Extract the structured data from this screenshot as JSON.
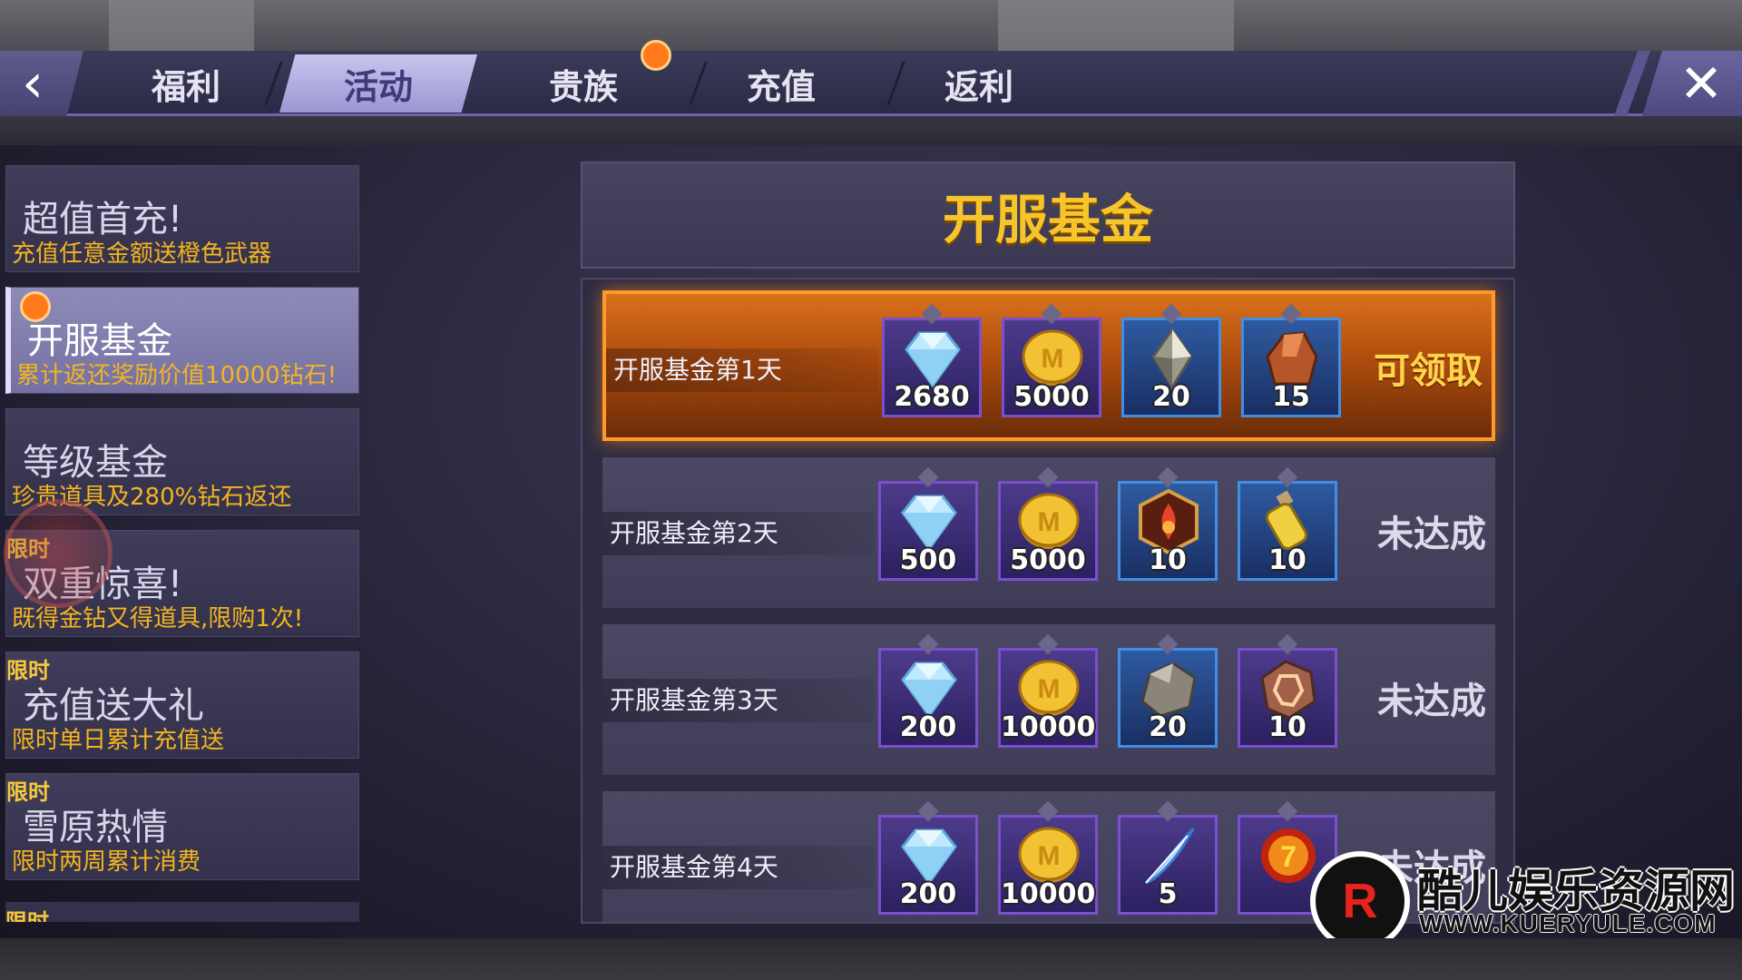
{
  "tabs": [
    {
      "label": "福利",
      "active": false
    },
    {
      "label": "活动",
      "active": true
    },
    {
      "label": "贵族",
      "active": false,
      "notify": true
    },
    {
      "label": "充值",
      "active": false
    },
    {
      "label": "返利",
      "active": false
    }
  ],
  "icons": {
    "back": "back-arrow-icon",
    "close": "close-icon"
  },
  "sidebar": {
    "items": [
      {
        "title": "超值首充!",
        "subtitle": "充值任意金额送橙色武器",
        "tag": "",
        "active": false
      },
      {
        "title": "开服基金",
        "subtitle": "累计返还奖励价值10000钻石!",
        "tag": "",
        "active": true,
        "notify": true
      },
      {
        "title": "等级基金",
        "subtitle": "珍贵道具及280%钻石返还",
        "tag": "",
        "active": false
      },
      {
        "title": "双重惊喜!",
        "subtitle": "既得金钻又得道具,限购1次!",
        "tag": "限时",
        "active": false
      },
      {
        "title": "充值送大礼",
        "subtitle": "限时单日累计充值送",
        "tag": "限时",
        "active": false
      },
      {
        "title": "雪原热情",
        "subtitle": "限时两周累计消费",
        "tag": "限时",
        "active": false
      }
    ],
    "partial_tag": "限时"
  },
  "panel": {
    "title": "开服基金",
    "rows": [
      {
        "label": "开服基金第1天",
        "status": "可领取",
        "claimable": true,
        "rewards": [
          {
            "icon": "diamond-icon",
            "count": "2680",
            "frame": "purple"
          },
          {
            "icon": "gold-coin-icon",
            "count": "5000",
            "frame": "purple"
          },
          {
            "icon": "crystal-shard-icon",
            "count": "20",
            "frame": "blue"
          },
          {
            "icon": "ore-icon",
            "count": "15",
            "frame": "blue"
          }
        ]
      },
      {
        "label": "开服基金第2天",
        "status": "未达成",
        "claimable": false,
        "rewards": [
          {
            "icon": "diamond-icon",
            "count": "500",
            "frame": "purple"
          },
          {
            "icon": "gold-coin-icon",
            "count": "5000",
            "frame": "purple"
          },
          {
            "icon": "fire-emblem-icon",
            "count": "10",
            "frame": "blue"
          },
          {
            "icon": "potion-icon",
            "count": "10",
            "frame": "blue"
          }
        ]
      },
      {
        "label": "开服基金第3天",
        "status": "未达成",
        "claimable": false,
        "rewards": [
          {
            "icon": "diamond-icon",
            "count": "200",
            "frame": "purple"
          },
          {
            "icon": "gold-coin-icon",
            "count": "10000",
            "frame": "purple"
          },
          {
            "icon": "stone-icon",
            "count": "20",
            "frame": "blue"
          },
          {
            "icon": "rune-stone-icon",
            "count": "10",
            "frame": "purple"
          }
        ]
      },
      {
        "label": "开服基金第4天",
        "status": "未达成",
        "claimable": false,
        "rewards": [
          {
            "icon": "diamond-icon",
            "count": "200",
            "frame": "purple"
          },
          {
            "icon": "gold-coin-icon",
            "count": "10000",
            "frame": "purple"
          },
          {
            "icon": "feather-icon",
            "count": "5",
            "frame": "purple"
          },
          {
            "icon": "fire-orb-icon",
            "count": "",
            "frame": "purple"
          }
        ]
      }
    ]
  },
  "watermark": {
    "logo_letter": "R",
    "name": "酷儿娱乐资源网",
    "url": "WWW.KUERYULE.COM"
  },
  "colors": {
    "accent_gold": "#f7c52a",
    "claim_orange": "#d9711c",
    "notify_dot": "#ff7a1a",
    "active_tab": "#c9c5ee"
  }
}
